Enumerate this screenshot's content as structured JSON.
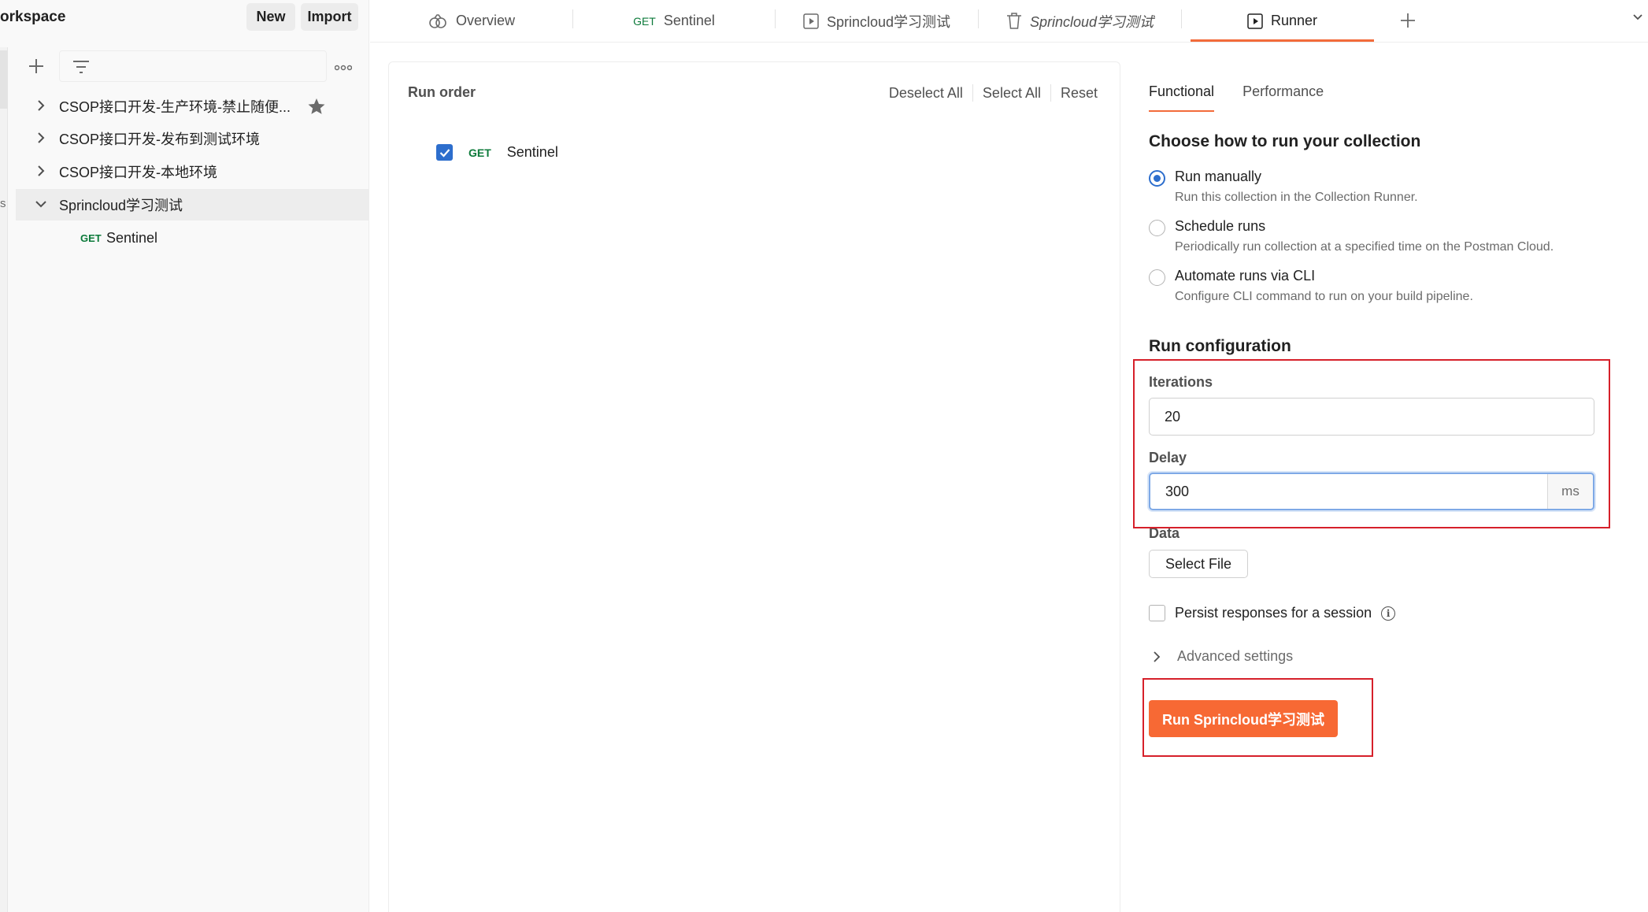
{
  "workspace": {
    "title": "orkspace",
    "new_label": "New",
    "import_label": "Import",
    "rail_letter": "s"
  },
  "sidebar": {
    "items": [
      {
        "label": "CSOP接口开发-生产环境-禁止随便...",
        "expanded": false,
        "starred": true
      },
      {
        "label": "CSOP接口开发-发布到测试环境",
        "expanded": false
      },
      {
        "label": "CSOP接口开发-本地环境",
        "expanded": false
      },
      {
        "label": "Sprincloud学习测试",
        "expanded": true
      }
    ],
    "request": {
      "method": "GET",
      "name": "Sentinel"
    }
  },
  "tabs": [
    {
      "label": "Overview",
      "icon": "overview-icon"
    },
    {
      "method": "GET",
      "label": "Sentinel"
    },
    {
      "label": "Sprincloud学习测试",
      "icon": "runner-play-icon"
    },
    {
      "label": "Sprincloud学习测试",
      "icon": "trash-icon",
      "italic": true
    },
    {
      "label": "Runner",
      "icon": "runner-play-icon",
      "active": true
    }
  ],
  "run_order": {
    "title": "Run order",
    "deselect_all": "Deselect All",
    "select_all": "Select All",
    "reset": "Reset",
    "requests": [
      {
        "method": "GET",
        "name": "Sentinel",
        "checked": true
      }
    ]
  },
  "config": {
    "tab_functional": "Functional",
    "tab_performance": "Performance",
    "choose_heading": "Choose how to run your collection",
    "options": [
      {
        "label": "Run manually",
        "desc": "Run this collection in the Collection Runner.",
        "selected": true
      },
      {
        "label": "Schedule runs",
        "desc": "Periodically run collection at a specified time on the Postman Cloud.",
        "selected": false
      },
      {
        "label": "Automate runs via CLI",
        "desc": "Configure CLI command to run on your build pipeline.",
        "selected": false
      }
    ],
    "run_config_heading": "Run configuration",
    "iterations_label": "Iterations",
    "iterations_value": "20",
    "delay_label": "Delay",
    "delay_value": "300",
    "delay_unit": "ms",
    "data_label": "Data",
    "select_file": "Select File",
    "persist_label": "Persist responses for a session",
    "info_glyph": "i",
    "advanced_label": "Advanced settings",
    "run_button": "Run Sprincloud学习测试"
  },
  "colors": {
    "accent": "#f76934",
    "checkbox": "#2d6ecd",
    "annotation": "#d6202a",
    "get_method": "#0c7a3a"
  }
}
